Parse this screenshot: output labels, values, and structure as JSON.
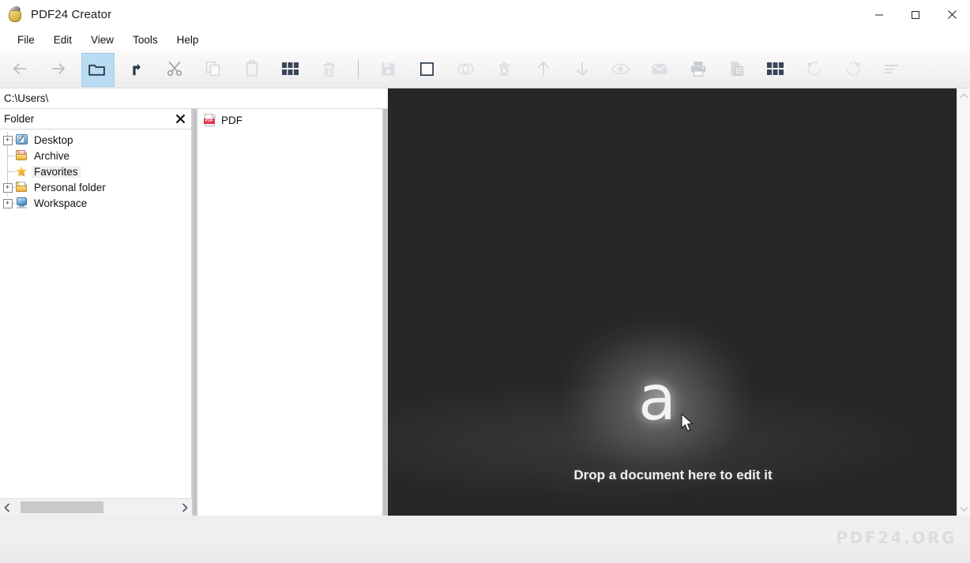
{
  "window": {
    "title": "PDF24 Creator",
    "logo_icon": "pdf24-bag-icon",
    "controls": [
      {
        "name": "minimize-button",
        "icon": "minimize-icon",
        "label": "—"
      },
      {
        "name": "maximize-button",
        "icon": "maximize-icon",
        "label": "□"
      },
      {
        "name": "close-button",
        "icon": "close-icon",
        "label": "✕"
      }
    ]
  },
  "menubar": {
    "items": [
      {
        "label": "File"
      },
      {
        "label": "Edit"
      },
      {
        "label": "View"
      },
      {
        "label": "Tools"
      },
      {
        "label": "Help"
      }
    ]
  },
  "toolbar": {
    "group_left": [
      {
        "name": "back-button",
        "icon": "arrow-left-icon",
        "tooltip": "Back",
        "state": "enabled"
      },
      {
        "name": "forward-button",
        "icon": "arrow-right-icon",
        "tooltip": "Forward",
        "state": "enabled"
      },
      {
        "name": "folder-button",
        "icon": "folder-icon",
        "tooltip": "Folder",
        "state": "active"
      },
      {
        "name": "up-button",
        "icon": "arrow-up-turn-icon",
        "tooltip": "Up one level",
        "state": "enabled"
      },
      {
        "name": "cut-button",
        "icon": "scissors-icon",
        "tooltip": "Cut",
        "state": "enabled"
      },
      {
        "name": "copy-button",
        "icon": "copy-icon",
        "tooltip": "Copy",
        "state": "disabled"
      },
      {
        "name": "paste-button",
        "icon": "clipboard-icon",
        "tooltip": "Paste",
        "state": "disabled"
      },
      {
        "name": "grid-button",
        "icon": "grid-icon",
        "tooltip": "Grid",
        "state": "enabled"
      },
      {
        "name": "delete-button",
        "icon": "trash-icon",
        "tooltip": "Delete",
        "state": "disabled"
      }
    ],
    "group_right": [
      {
        "name": "save-button",
        "icon": "floppy-save-icon",
        "tooltip": "Save",
        "state": "disabled"
      },
      {
        "name": "select-button",
        "icon": "square-select-icon",
        "tooltip": "Select",
        "state": "enabled"
      },
      {
        "name": "merge-button",
        "icon": "merge-circles-icon",
        "tooltip": "Merge",
        "state": "disabled"
      },
      {
        "name": "delete-page-button",
        "icon": "trash-x-icon",
        "tooltip": "Delete page",
        "state": "disabled"
      },
      {
        "name": "move-up-button",
        "icon": "arrow-up-icon",
        "tooltip": "Move up",
        "state": "disabled"
      },
      {
        "name": "move-down-button",
        "icon": "arrow-down-icon",
        "tooltip": "Move down",
        "state": "disabled"
      },
      {
        "name": "preview-button",
        "icon": "eye-icon",
        "tooltip": "Preview",
        "state": "disabled"
      },
      {
        "name": "email-button",
        "icon": "envelope-icon",
        "tooltip": "Send by email",
        "state": "disabled"
      },
      {
        "name": "print-button",
        "icon": "printer-icon",
        "tooltip": "Print",
        "state": "disabled"
      },
      {
        "name": "fax-button",
        "icon": "fax-icon",
        "tooltip": "Fax",
        "state": "disabled"
      },
      {
        "name": "pages-grid-button",
        "icon": "grid-icon",
        "tooltip": "Page grid",
        "state": "enabled"
      },
      {
        "name": "rotate-left-button",
        "icon": "rotate-left-icon",
        "tooltip": "Rotate left",
        "state": "disabled"
      },
      {
        "name": "rotate-right-button",
        "icon": "rotate-right-icon",
        "tooltip": "Rotate right",
        "state": "disabled"
      },
      {
        "name": "sort-button",
        "icon": "sort-lines-icon",
        "tooltip": "Sort",
        "state": "disabled"
      }
    ]
  },
  "path_bar": {
    "value": "C:\\Users\\"
  },
  "folder_panel": {
    "header": "Folder",
    "close_icon": "close-icon",
    "tree": [
      {
        "label": "Desktop",
        "icon": "desktop-icon",
        "expandable": true,
        "expander": "+",
        "selected": false
      },
      {
        "label": "Archive",
        "icon": "folder-pink-doc-icon",
        "expandable": false,
        "expander": "",
        "selected": false
      },
      {
        "label": "Favorites",
        "icon": "star-icon",
        "expandable": false,
        "expander": "",
        "selected": true
      },
      {
        "label": "Personal folder",
        "icon": "folder-doc-icon",
        "expandable": true,
        "expander": "+",
        "selected": false
      },
      {
        "label": "Workspace",
        "icon": "computer-icon",
        "expandable": true,
        "expander": "+",
        "selected": false
      }
    ],
    "scrollbar": {
      "left_arrow": "‹",
      "right_arrow": "›"
    }
  },
  "file_panel": {
    "items": [
      {
        "label": "PDF",
        "icon": "pdf-file-icon",
        "badge": "PDF"
      }
    ]
  },
  "drop_area": {
    "logo_glyph": "a",
    "message": "Drop a document here to edit it",
    "cursor_icon": "mouse-pointer-icon",
    "background_color": "#272728"
  },
  "status_bar": {
    "watermark": "PDF24.ORG"
  }
}
